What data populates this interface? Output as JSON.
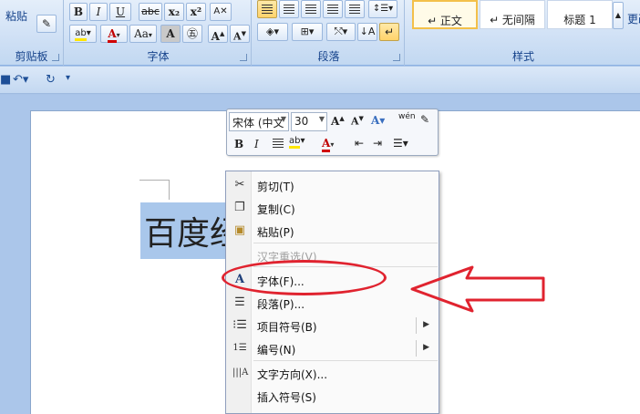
{
  "ribbon": {
    "clipboard": {
      "paste_label": "粘贴",
      "group_label": "剪贴板"
    },
    "font": {
      "group_label": "字体",
      "bold": "B",
      "italic": "I",
      "underline": "U",
      "strike": "abc",
      "subscript": "x₂",
      "superscript": "x²",
      "font_color_letter": "A",
      "change_case": "Aa",
      "grow_font": "A",
      "shrink_font": "A"
    },
    "paragraph": {
      "group_label": "段落"
    },
    "styles": {
      "group_label": "样式",
      "items": [
        "↵ 正文",
        "↵ 无间隔",
        "标题 1"
      ],
      "change_label": "更改"
    }
  },
  "mini_toolbar": {
    "font_name": "宋体 (中文",
    "font_size": "30",
    "bold": "B",
    "italic": "I",
    "font_color_letter": "A"
  },
  "document": {
    "selected_text": "百度经"
  },
  "context_menu": {
    "items": [
      {
        "label": "剪切(T)",
        "icon": "scissors-icon"
      },
      {
        "label": "复制(C)",
        "icon": "copy-icon"
      },
      {
        "label": "粘贴(P)",
        "icon": "paste-icon"
      },
      {
        "label": "汉字重选(V)",
        "icon": "",
        "disabled": true
      },
      {
        "label": "字体(F)...",
        "icon": "font-icon"
      },
      {
        "label": "段落(P)...",
        "icon": "paragraph-icon"
      },
      {
        "label": "项目符号(B)",
        "icon": "bullets-icon",
        "submenu": true
      },
      {
        "label": "编号(N)",
        "icon": "numbering-icon",
        "submenu": true
      },
      {
        "label": "文字方向(X)...",
        "icon": "text-direction-icon"
      },
      {
        "label": "插入符号(S)",
        "icon": ""
      }
    ]
  },
  "annotation_color": "#e0232f"
}
